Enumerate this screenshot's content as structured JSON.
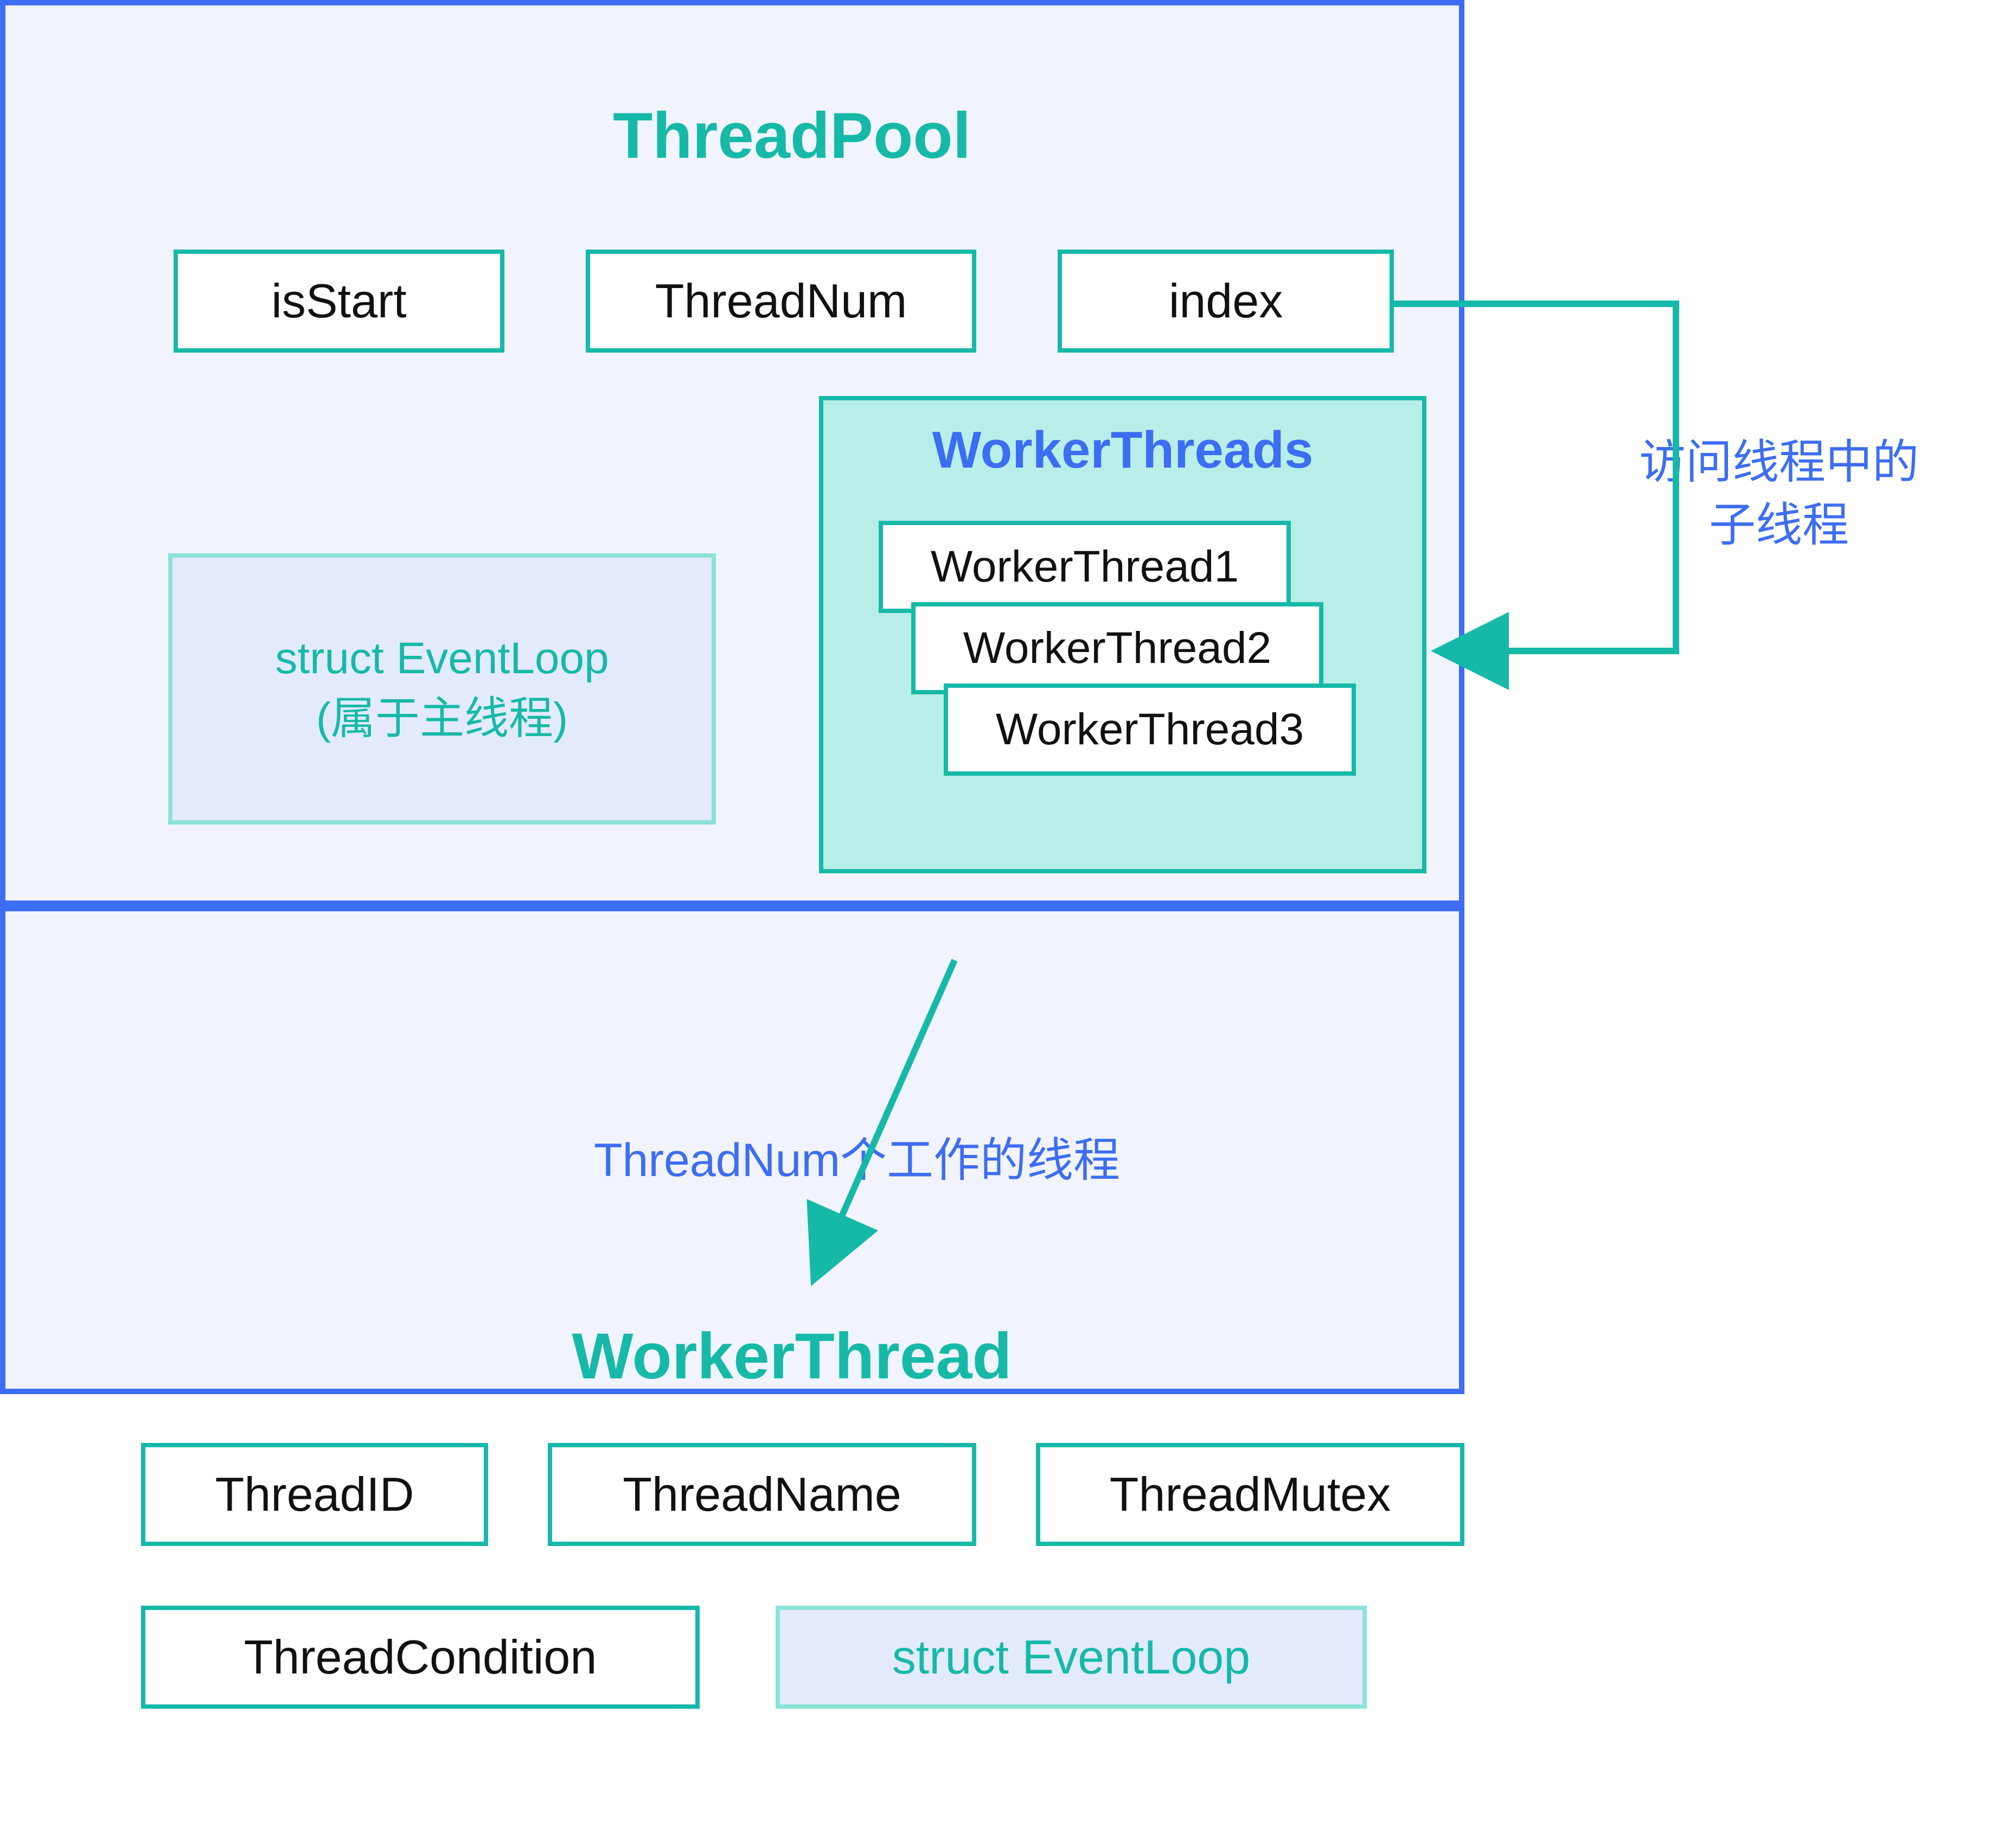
{
  "threadpool": {
    "title": "ThreadPool",
    "isStart": "isStart",
    "threadNum": "ThreadNum",
    "index": "index",
    "eventLoopLine1": "struct EventLoop",
    "eventLoopLine2": "(属于主线程)",
    "workerThreadsTitle": "WorkerThreads",
    "wt1": "WorkerThread1",
    "wt2": "WorkerThread2",
    "wt3": "WorkerThread3"
  },
  "sideLabel": {
    "line1": "访问线程中的",
    "line2": "子线程"
  },
  "midLabel": "ThreadNum个工作的线程",
  "workerthread": {
    "title": "WorkerThread",
    "threadId": "ThreadID",
    "threadName": "ThreadName",
    "threadMutex": "ThreadMutex",
    "threadCondition": "ThreadCondition",
    "eventLoop": "struct EventLoop"
  },
  "colors": {
    "blue": "#3d6df2",
    "teal": "#16b9a8",
    "panelBg": "#f1f4ff",
    "lightTealBg": "#b8eee8",
    "lightBlueBg": "#e3eafc",
    "lightTealBorder": "#8be3d8"
  }
}
